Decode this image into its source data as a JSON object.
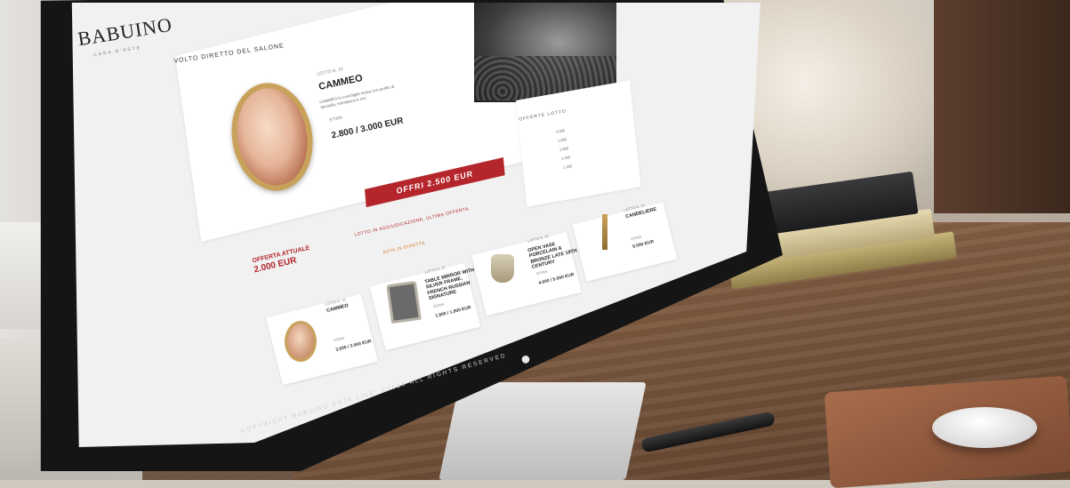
{
  "site": {
    "brand": "BABUINO",
    "brand_sub": "CASA D'ASTE"
  },
  "main_lot": {
    "back_link": "VOLTO DIRETTO DEL SALONE",
    "lot_number": "LOTTO N. 15",
    "title": "CAMMEO",
    "description": "CAMMEO in conchiglia incisa con profilo di fanciulla, montatura in oro.",
    "estimate_label": "STIMA",
    "estimate_value": "2.800 / 3.000 EUR",
    "offer_button": "OFFRI 2.500 EUR",
    "current_offer_label": "OFFERTA ATTUALE",
    "current_offer_value": "2.000 EUR",
    "scroll_notice": "LOTTO IN AGGIUDICAZIONE, ULTIMA OFFERTA",
    "live_badge": "ASTA IN DIRETTA"
  },
  "offers_panel": {
    "title": "OFFERTE LOTTO",
    "rows": [
      "2.000",
      "1.800",
      "1.600",
      "1.400",
      "1.200"
    ]
  },
  "upcoming": [
    {
      "lot": "LOTTO N. 16",
      "title": "CAMMEO",
      "stima": "STIMA",
      "value": "3.000 / 3.500 EUR"
    },
    {
      "lot": "LOTTO N. 17",
      "title": "TABLE MIRROR WITH SILVER FRAME, FRENCH RUSSIAN SIGNATURE",
      "stima": "STIMA",
      "value": "1.800 / 1.900 EUR"
    },
    {
      "lot": "LOTTO N. 18",
      "title": "OPEN VASE PORCELAIN & BRONZE LATE 19TH CENTURY",
      "stima": "STIMA",
      "value": "4.000 / 5.000 EUR"
    },
    {
      "lot": "LOTTO N. 19",
      "title": "CANDELIERE",
      "stima": "STIMA",
      "value": "5.000 EUR"
    }
  ],
  "footer": {
    "copyright": "COPYRIGHT BABUINO ASTA LIVE. ©2020 ALL RIGHTS RESERVED"
  },
  "colors": {
    "accent_red": "#b4262b",
    "accent_orange": "#d17a2a",
    "gold_frame": "#c8a25a"
  }
}
